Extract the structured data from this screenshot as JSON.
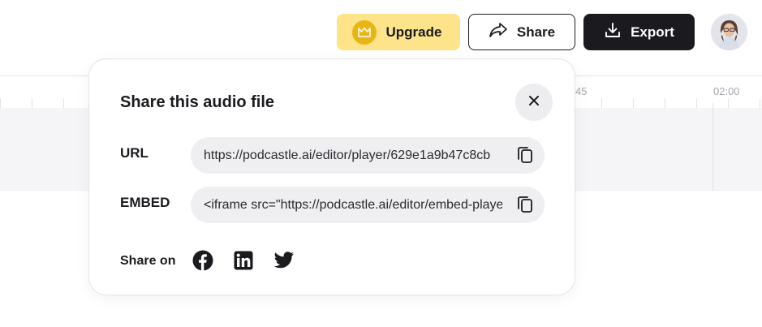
{
  "toolbar": {
    "upgrade_label": "Upgrade",
    "share_label": "Share",
    "export_label": "Export"
  },
  "timeline": {
    "labels": [
      "45",
      "02:00"
    ]
  },
  "share_popover": {
    "title": "Share this audio file",
    "url_label": "URL",
    "url_value": "https://podcastle.ai/editor/player/629e1a9b47c8cb",
    "embed_label": "EMBED",
    "embed_value": "<iframe src=\"https://podcastle.ai/editor/embed-player",
    "share_on_label": "Share on",
    "social": [
      "facebook-icon",
      "linkedin-icon",
      "twitter-icon"
    ]
  },
  "colors": {
    "upgrade_bg": "#fde38a",
    "crown_bg": "#e8b516",
    "export_bg": "#1b1b1f",
    "field_bg": "#efeff2"
  }
}
